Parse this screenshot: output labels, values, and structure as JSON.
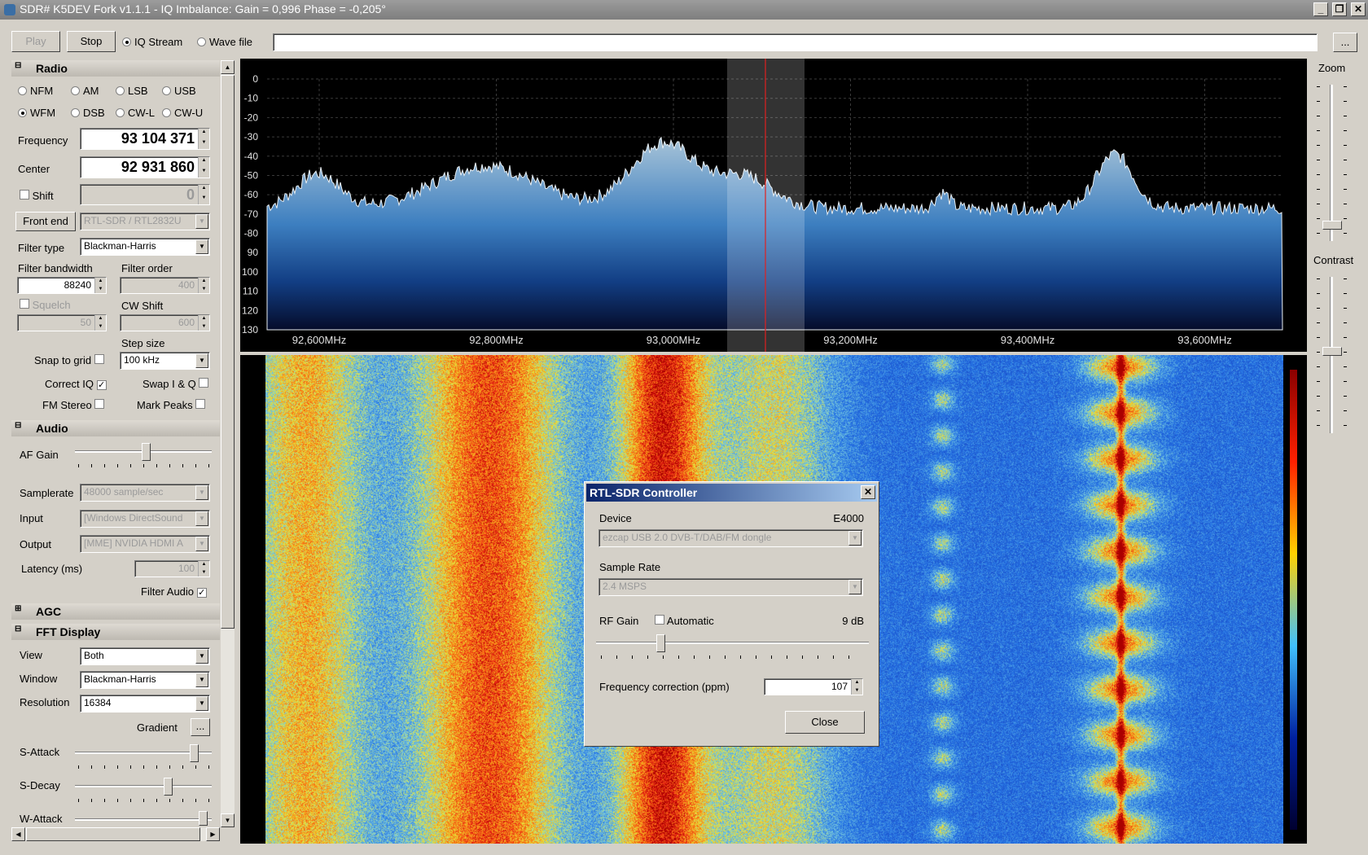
{
  "window": {
    "title": "SDR# K5DEV Fork v1.1.1 - IQ Imbalance: Gain = 0,996 Phase = -0,205°"
  },
  "toolbar": {
    "play": "Play",
    "stop": "Stop",
    "iq_stream": "IQ Stream",
    "wave_file": "Wave file",
    "browse": "..."
  },
  "radio": {
    "title": "Radio",
    "modes": [
      "NFM",
      "AM",
      "LSB",
      "USB",
      "WFM",
      "DSB",
      "CW-L",
      "CW-U"
    ],
    "selected_mode": "WFM",
    "frequency_label": "Frequency",
    "frequency": "93 104 371",
    "center_label": "Center",
    "center": "92 931 860",
    "shift_label": "Shift",
    "shift": "0",
    "front_end": "Front end",
    "front_end_device": "RTL-SDR / RTL2832U",
    "filter_type_label": "Filter type",
    "filter_type": "Blackman-Harris",
    "filter_bw_label": "Filter bandwidth",
    "filter_bw": "88240",
    "filter_order_label": "Filter order",
    "filter_order": "400",
    "squelch_label": "Squelch",
    "squelch": "50",
    "cw_shift_label": "CW Shift",
    "cw_shift": "600",
    "step_size_label": "Step size",
    "step_size": "100 kHz",
    "snap_label": "Snap to grid",
    "correct_iq_label": "Correct IQ",
    "swap_label": "Swap I & Q",
    "fm_stereo_label": "FM Stereo",
    "mark_peaks_label": "Mark Peaks"
  },
  "audio": {
    "title": "Audio",
    "af_gain_label": "AF Gain",
    "samplerate_label": "Samplerate",
    "samplerate": "48000 sample/sec",
    "input_label": "Input",
    "input": "[Windows DirectSound",
    "output_label": "Output",
    "output": "[MME] NVIDIA HDMI A",
    "latency_label": "Latency (ms)",
    "latency": "100",
    "filter_audio_label": "Filter Audio"
  },
  "agc": {
    "title": "AGC"
  },
  "fft": {
    "title": "FFT Display",
    "view_label": "View",
    "view": "Both",
    "window_label": "Window",
    "window": "Blackman-Harris",
    "resolution_label": "Resolution",
    "resolution": "16384",
    "gradient_label": "Gradient",
    "gradient_btn": "...",
    "s_attack_label": "S-Attack",
    "s_decay_label": "S-Decay",
    "w_attack_label": "W-Attack"
  },
  "right": {
    "zoom": "Zoom",
    "contrast": "Contrast"
  },
  "spectrum": {
    "db_ticks": [
      "0",
      "-10",
      "-20",
      "-30",
      "-40",
      "-50",
      "-60",
      "-70",
      "-80",
      "90",
      "100",
      "110",
      "120",
      "130"
    ],
    "freq_ticks": [
      "92,600MHz",
      "92,800MHz",
      "93,000MHz",
      "93,200MHz",
      "93,400MHz",
      "93,600MHz"
    ]
  },
  "dialog": {
    "title": "RTL-SDR Controller",
    "device_label": "Device",
    "tuner": "E4000",
    "device": "ezcap USB 2.0 DVB-T/DAB/FM dongle",
    "sample_rate_label": "Sample Rate",
    "sample_rate": "2.4 MSPS",
    "rf_gain_label": "RF Gain",
    "automatic_label": "Automatic",
    "rf_gain_value": "9 dB",
    "freq_corr_label": "Frequency correction (ppm)",
    "freq_corr": "107",
    "close": "Close"
  }
}
